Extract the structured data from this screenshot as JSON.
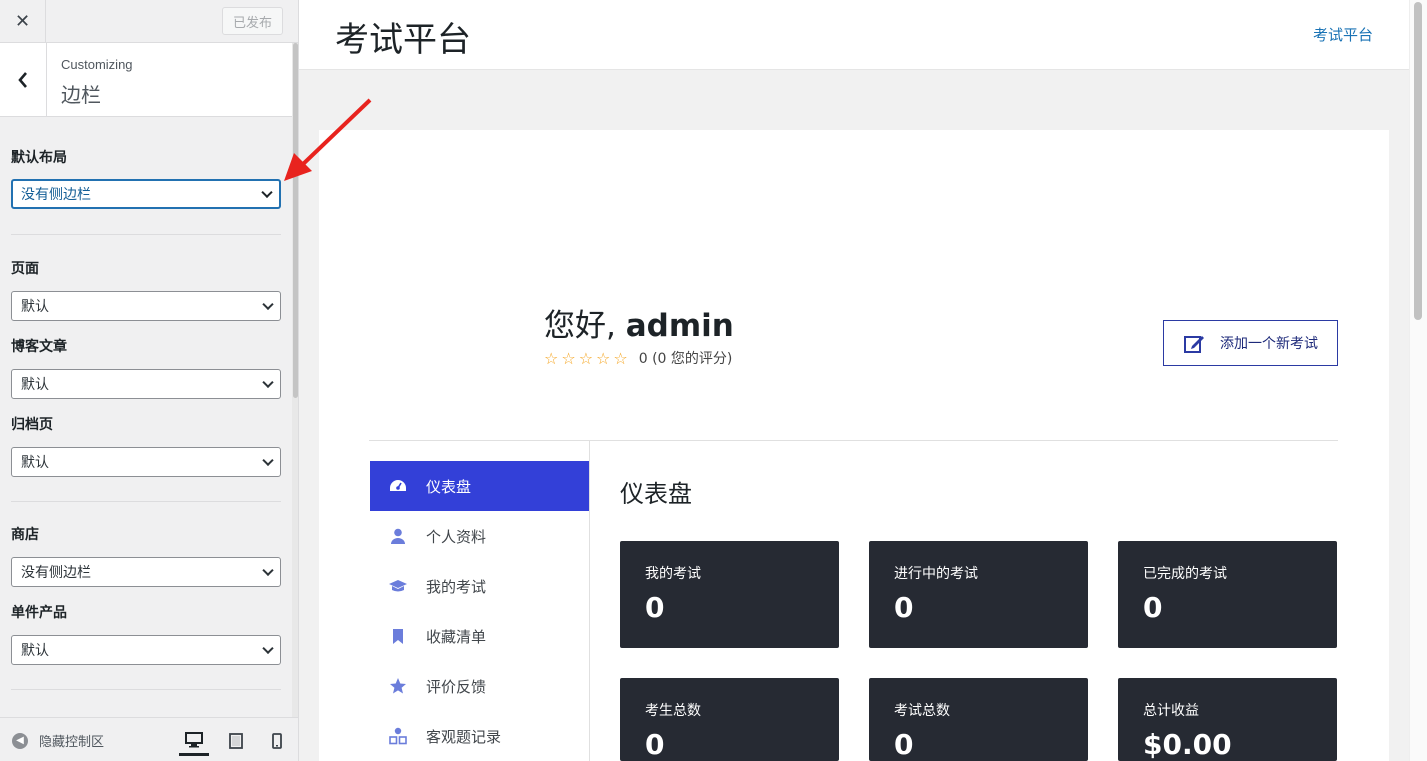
{
  "customizer": {
    "close_label": "✕",
    "published_label": "已发布",
    "crumb": "Customizing",
    "section_title": "边栏",
    "groups": [
      {
        "label": "默认布局",
        "value": "没有侧边栏"
      },
      {
        "label": "页面",
        "value": "默认"
      },
      {
        "label": "博客文章",
        "value": "默认"
      },
      {
        "label": "归档页",
        "value": "默认"
      },
      {
        "label": "商店",
        "value": "没有侧边栏"
      },
      {
        "label": "单件产品",
        "value": "默认"
      }
    ],
    "footer": {
      "hide_label": "隐藏控制区"
    },
    "devices": [
      "desktop-icon",
      "tablet-icon",
      "mobile-icon"
    ]
  },
  "preview": {
    "site_title": "考试平台",
    "nav_link": "考试平台",
    "greeting_prefix": "您好, ",
    "greeting_name": "admin",
    "rating_text": "0 (0 您的评分)",
    "add_button": "添加一个新考试",
    "menu": [
      {
        "label": "仪表盘",
        "icon": "dashboard-icon",
        "active": true
      },
      {
        "label": "个人资料",
        "icon": "user-icon",
        "active": false
      },
      {
        "label": "我的考试",
        "icon": "graduation-cap-icon",
        "active": false
      },
      {
        "label": "收藏清单",
        "icon": "bookmark-icon",
        "active": false
      },
      {
        "label": "评价反馈",
        "icon": "star-icon",
        "active": false
      },
      {
        "label": "客观题记录",
        "icon": "shapes-icon",
        "active": false
      }
    ],
    "dashboard_title": "仪表盘",
    "stats": [
      {
        "label": "我的考试",
        "value": "0"
      },
      {
        "label": "进行中的考试",
        "value": "0"
      },
      {
        "label": "已完成的考试",
        "value": "0"
      },
      {
        "label": "考生总数",
        "value": "0"
      },
      {
        "label": "考试总数",
        "value": "0"
      },
      {
        "label": "总计收益",
        "value": "$0.00"
      }
    ]
  },
  "colors": {
    "accent": "#3340d8",
    "tile_bg": "#262a33",
    "link": "#1a73b5",
    "arrow": "#e8231e"
  }
}
